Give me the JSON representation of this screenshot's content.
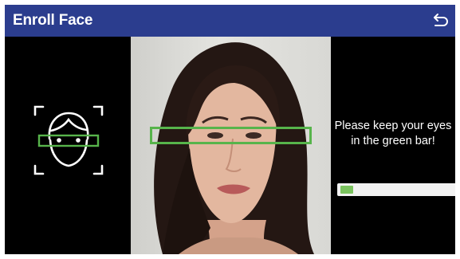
{
  "header": {
    "title": "Enroll Face",
    "back_icon": "return-arrow-icon",
    "background_color": "#2b3d8e"
  },
  "guide": {
    "icon": "face-scan-frame-icon"
  },
  "camera": {
    "eye_guide_color": "#57b44b"
  },
  "instruction": {
    "text": "Please keep your eyes in the green bar!"
  },
  "progress": {
    "value_fraction": 0.11,
    "fill_color": "#7ac35e"
  }
}
